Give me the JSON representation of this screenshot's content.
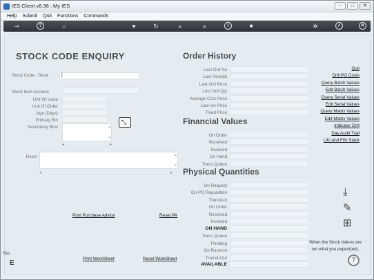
{
  "window": {
    "title": "IES Client v8.36 : My IES",
    "min": "–",
    "max": "□",
    "close": "✕"
  },
  "menu": [
    "Help",
    "Submit",
    "Quit",
    "Functions",
    "Commands"
  ],
  "toolbar": [
    {
      "name": "key-icon",
      "glyph": "⊸"
    },
    {
      "name": "help-icon",
      "glyph": "?"
    },
    {
      "name": "search-icon",
      "glyph": "⌕"
    },
    {
      "name": "favorite-icon",
      "glyph": "♥"
    },
    {
      "name": "refresh-icon",
      "glyph": "↻"
    },
    {
      "name": "rewind-icon",
      "glyph": "«"
    },
    {
      "name": "forward-icon",
      "glyph": "»"
    },
    {
      "name": "info-icon",
      "glyph": "i"
    },
    {
      "name": "stop-icon",
      "glyph": "■"
    },
    {
      "name": "settings-icon",
      "glyph": "✲"
    },
    {
      "name": "confirm-icon",
      "glyph": "✓"
    },
    {
      "name": "close-icon",
      "glyph": "✕"
    }
  ],
  "stock_code_enquiry": {
    "heading": "STOCK   CODE   ENQUIRY",
    "labels": {
      "stock_code": "Stock Code - Store",
      "stock_item_account": "Stock Item Account",
      "unit_of_issue": "Unit Of Issue",
      "unit_of_order": "Unit Of Order",
      "age_days": "Age (Days)",
      "primary_bin": "Primary Bin",
      "secondary_bins": "Secondary Bins",
      "descr": "Descr"
    },
    "stock_code_value": "",
    "actions": {
      "print_purchase_advice": "Print Purchase Advice",
      "reset_pa": "Reset PA",
      "print_worksheet": "Print WorkSheet",
      "reset_worksheet": "Reset WorkSheet"
    }
  },
  "order_history": {
    "heading": "Order History",
    "labels": [
      "Last Ord No",
      "Last Receipt",
      "Last Ord Price",
      "Last Ord Qty",
      "Average Cost Price",
      "Last Inv Price",
      "Fixed Price"
    ]
  },
  "financial_values": {
    "heading": "Financial Values",
    "labels": [
      "On Order",
      "Received",
      "Invoiced",
      "On Hand",
      "Trans Queue"
    ]
  },
  "physical_quantities": {
    "heading": "Physical Quantities",
    "labels": [
      "On Request",
      "On PO Requisition",
      "Transit-In",
      "On Order",
      "Received",
      "Invoiced",
      "ON HAND",
      "Trans Queue",
      "Pending",
      "On Reserve",
      "Transit-Out",
      "AVAILABLE"
    ]
  },
  "right_links": [
    "Quit",
    "Drill PO Costs",
    "Query Batch Values",
    "Edit Batch Values",
    "Query Serial Values",
    "Edit Serial Values",
    "Query Matrix Values",
    "Edit Matrix Values",
    "Indicator Drill",
    "Day Audit Trail",
    "Lifo and Fifo Stack"
  ],
  "note": {
    "line1": "When the Stock Values are",
    "line2": "not what you expect(ed)..."
  },
  "left_edge": {
    "top": "Ses",
    "bottom": "E"
  }
}
